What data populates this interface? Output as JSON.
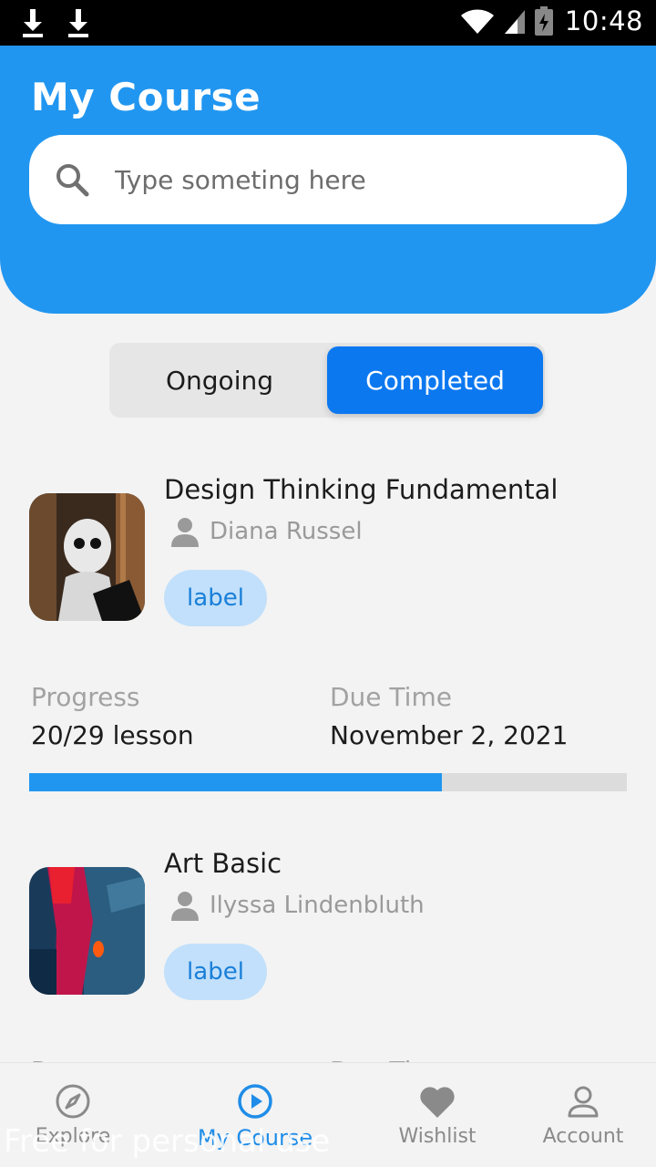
{
  "status_bar": {
    "time": "10:48"
  },
  "header": {
    "title": "My Course",
    "search": {
      "placeholder": "Type someting here",
      "value": ""
    }
  },
  "segment": {
    "ongoing": "Ongoing",
    "completed": "Completed",
    "selected": "Completed"
  },
  "courses": [
    {
      "title": "Design Thinking Fundamental",
      "author": "Diana Russel",
      "label": "label",
      "progress_label": "Progress",
      "progress_value": "20/29 lesson",
      "due_label": "Due Time",
      "due_value": "November 2, 2021",
      "progress_fraction": 0.69
    },
    {
      "title": "Art Basic",
      "author": "Ilyssa Lindenbluth",
      "label": "label",
      "progress_label": "Progress",
      "due_label": "Due Time"
    }
  ],
  "bottom_nav": {
    "items": [
      {
        "label": "Explore",
        "icon": "compass-icon"
      },
      {
        "label": "My Course",
        "icon": "play-circle-icon"
      },
      {
        "label": "Wishlist",
        "icon": "heart-icon"
      },
      {
        "label": "Account",
        "icon": "user-icon"
      }
    ],
    "active": "My Course"
  },
  "watermark": "Free for personal use",
  "colors": {
    "primary": "#2196f0",
    "segment_active": "#0c78f0",
    "label_bg": "#c2e0fb",
    "label_text": "#1a7fd8"
  }
}
